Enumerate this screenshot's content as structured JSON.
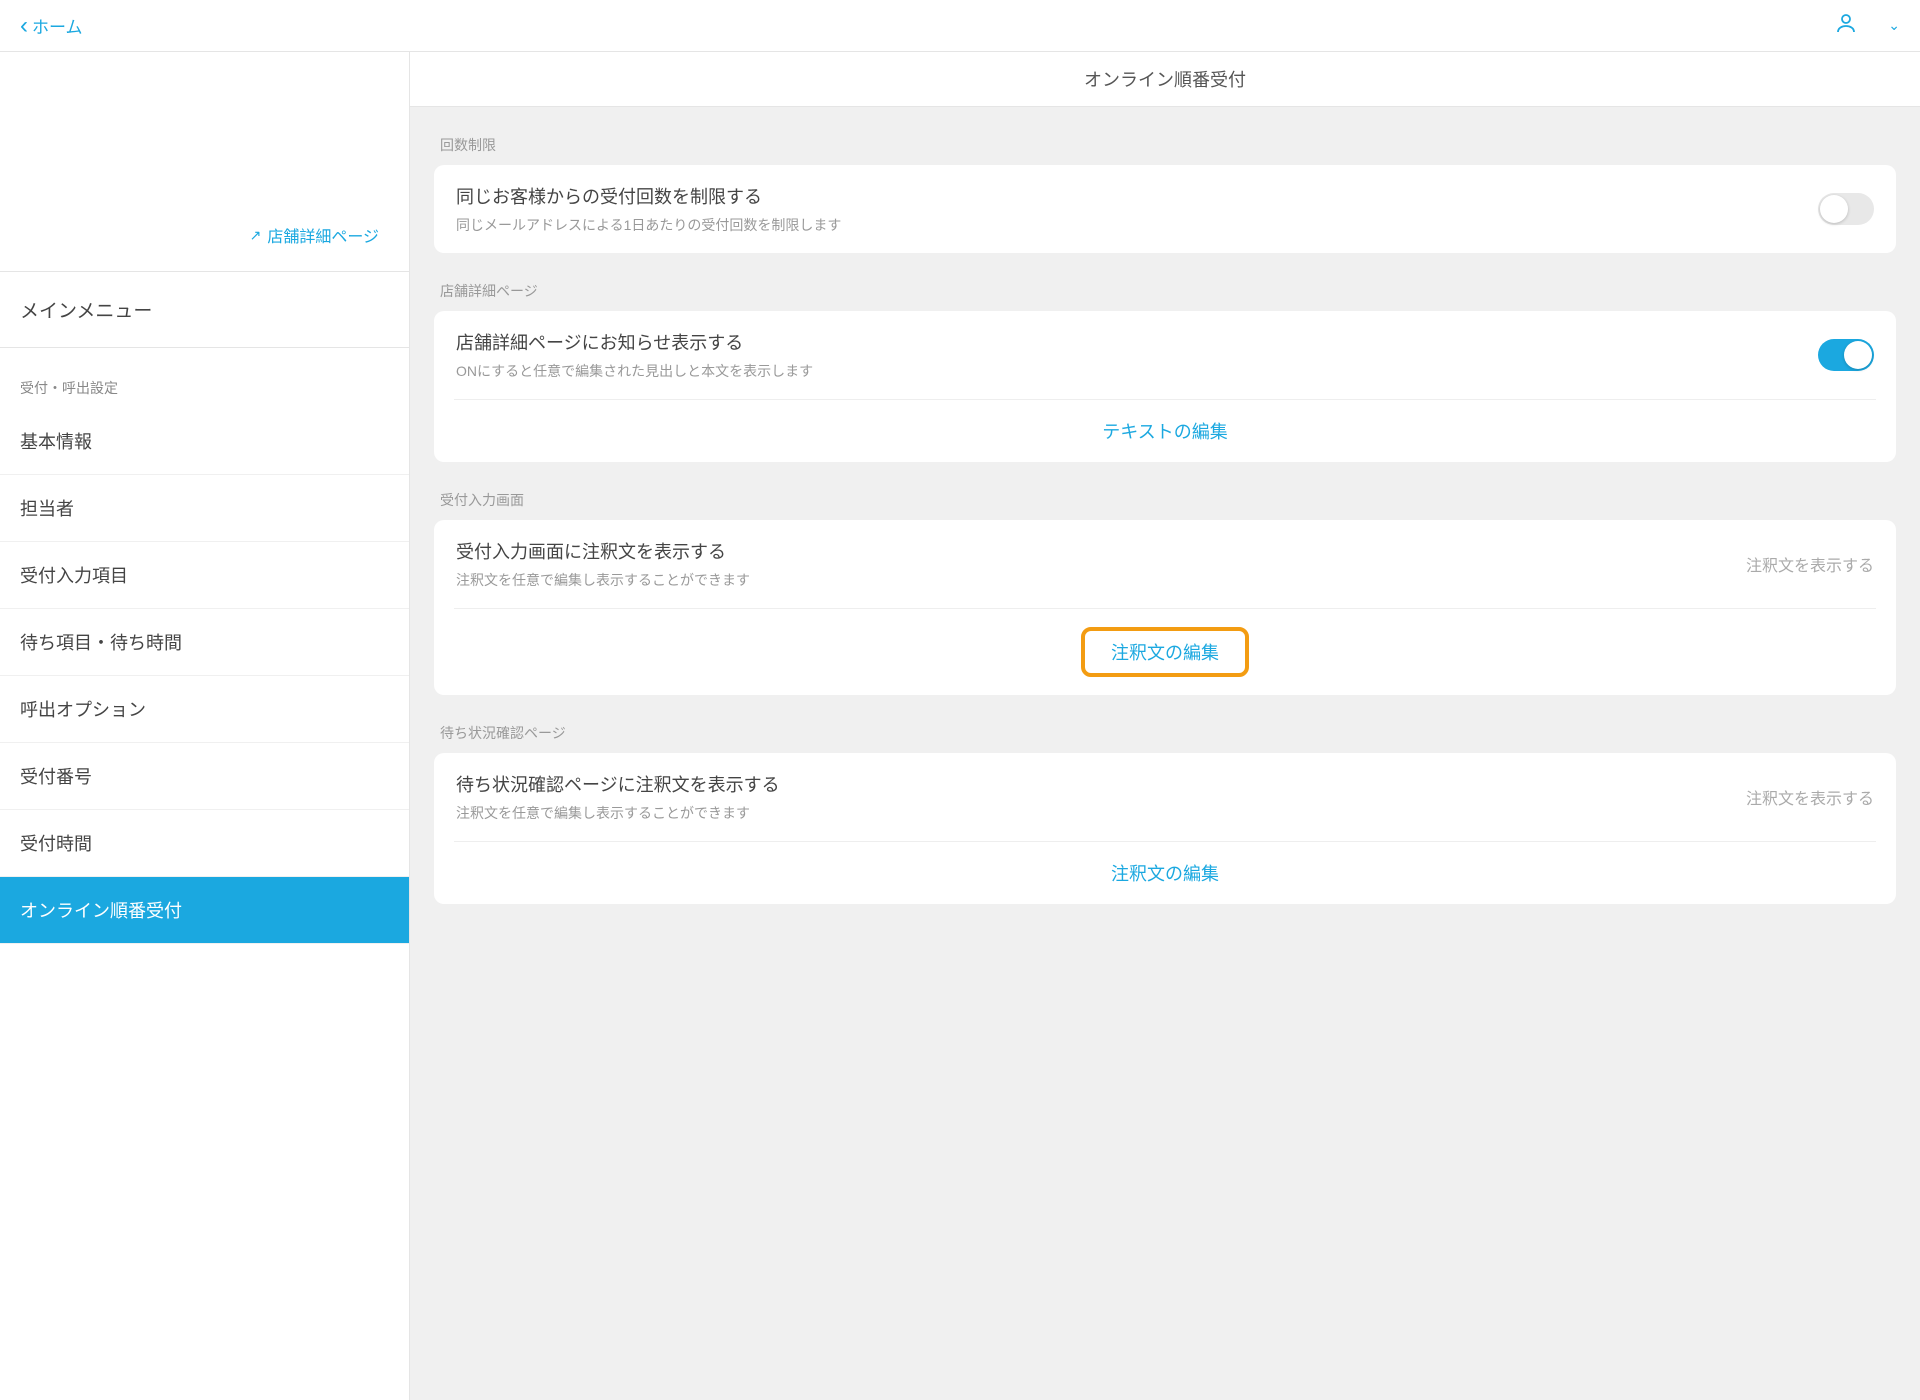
{
  "topbar": {
    "back_label": "ホーム"
  },
  "sidebar": {
    "store_link": "店舗詳細ページ",
    "menu_header": "メインメニュー",
    "section_label": "受付・呼出設定",
    "items": [
      {
        "label": "基本情報"
      },
      {
        "label": "担当者"
      },
      {
        "label": "受付入力項目"
      },
      {
        "label": "待ち項目・待ち時間"
      },
      {
        "label": "呼出オプション"
      },
      {
        "label": "受付番号"
      },
      {
        "label": "受付時間"
      },
      {
        "label": "オンライン順番受付"
      }
    ]
  },
  "main": {
    "title": "オンライン順番受付",
    "sections": {
      "limit": {
        "group_label": "回数制限",
        "title": "同じお客様からの受付回数を制限する",
        "sub": "同じメールアドレスによる1日あたりの受付回数を制限します",
        "toggle": "off"
      },
      "store_detail": {
        "group_label": "店舗詳細ページ",
        "title": "店舗詳細ページにお知らせ表示する",
        "sub": "ONにすると任意で編集された見出しと本文を表示します",
        "toggle": "on",
        "action": "テキストの編集"
      },
      "input_screen": {
        "group_label": "受付入力画面",
        "title": "受付入力画面に注釈文を表示する",
        "sub": "注釈文を任意で編集し表示することができます",
        "right_label": "注釈文を表示する",
        "action": "注釈文の編集"
      },
      "wait_status": {
        "group_label": "待ち状況確認ページ",
        "title": "待ち状況確認ページに注釈文を表示する",
        "sub": "注釈文を任意で編集し表示することができます",
        "right_label": "注釈文を表示する",
        "action": "注釈文の編集"
      }
    }
  }
}
